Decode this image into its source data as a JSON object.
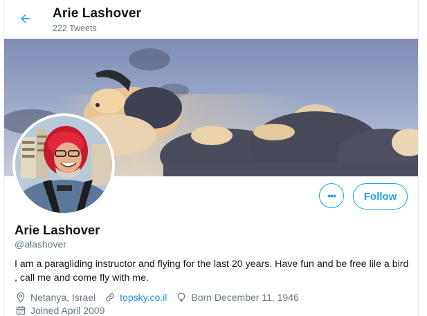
{
  "header": {
    "back_icon": "arrow-left-icon",
    "title": "Arie Lashover",
    "subtitle": "222 Tweets"
  },
  "banner": {
    "description_icon": "sky-clouds-paraglider-image"
  },
  "profile": {
    "avatar_icon": "avatar-photo",
    "more_label": "•••",
    "follow_label": "Follow",
    "name": "Arie Lashover",
    "handle": "@alashover",
    "bio": "I am a paragliding instructor and flying for the last 20 years. Have fun and be free lile a bird , call me and come fly with me.",
    "location": "Netanya, Israel",
    "website": "topsky.co.il",
    "birthday": "Born December 11, 1946",
    "joined": "Joined April 2009"
  },
  "colors": {
    "accent": "#1da1f2",
    "link": "#1b95e0",
    "muted": "#657786",
    "text": "#14171a"
  }
}
